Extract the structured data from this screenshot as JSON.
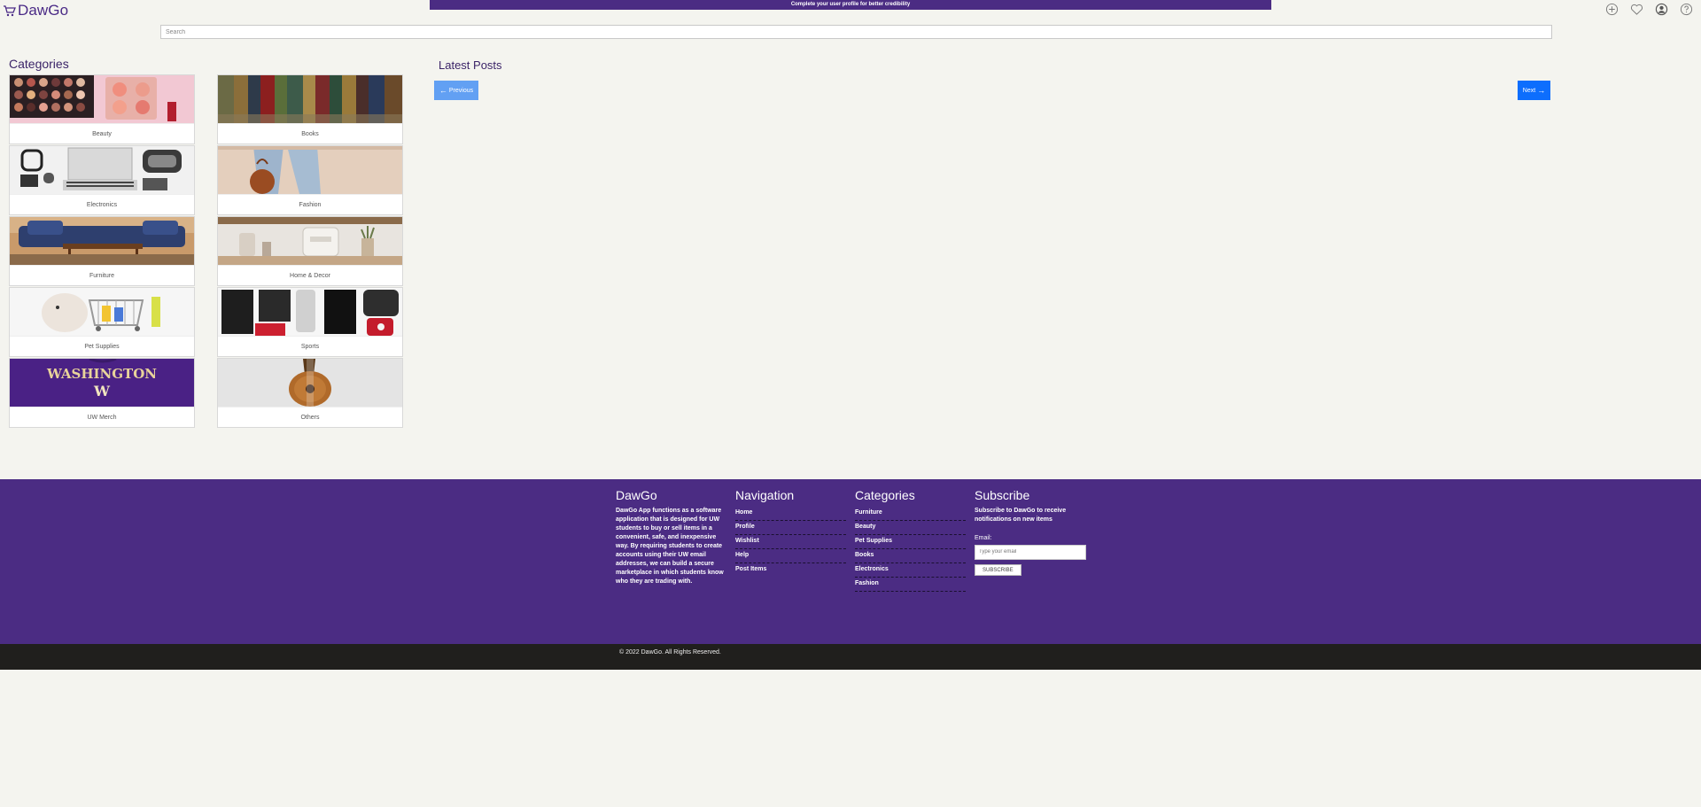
{
  "header": {
    "logo_text": "DawGo",
    "banner_text": "Complete your user profile for better credibility",
    "search_placeholder": "Search",
    "icons": [
      "add-icon",
      "heart-icon",
      "user-icon",
      "help-icon"
    ]
  },
  "categories": {
    "title": "Categories",
    "items": [
      {
        "label": "Beauty",
        "image": "beauty"
      },
      {
        "label": "Books",
        "image": "books"
      },
      {
        "label": "Electronics",
        "image": "electronics"
      },
      {
        "label": "Fashion",
        "image": "fashion"
      },
      {
        "label": "Furniture",
        "image": "furniture"
      },
      {
        "label": "Home & Decor",
        "image": "home-decor"
      },
      {
        "label": "Pet Supplies",
        "image": "pet-supplies"
      },
      {
        "label": "Sports",
        "image": "sports"
      },
      {
        "label": "UW Merch",
        "image": "uw-merch"
      },
      {
        "label": "Others",
        "image": "others"
      }
    ]
  },
  "posts": {
    "title": "Latest Posts",
    "prev_label": "Previous",
    "next_label": "Next"
  },
  "footer": {
    "about_title": "DawGo",
    "about_text": "DawGo App functions as a software application that is designed for UW students to buy or sell items in a convenient, safe, and inexpensive way. By requiring students to create accounts using their UW email addresses, we can build a secure marketplace in which students know who they are trading with.",
    "nav_title": "Navigation",
    "nav_links": [
      "Home",
      "Profile",
      "Wishlist",
      "Help",
      "Post Items"
    ],
    "cat_title": "Categories",
    "cat_links": [
      "Furniture",
      "Beauty",
      "Pet Supplies",
      "Books",
      "Electronics",
      "Fashion"
    ],
    "sub_title": "Subscribe",
    "sub_text": "Subscribe to DawGo to receive notifications on new items",
    "email_label": "Email:",
    "email_placeholder": "Type your email",
    "sub_button": "SUBSCRIBE"
  },
  "copyright": "© 2022 DawGo. All Rights Reserved.",
  "colors": {
    "brand_purple": "#4b2c83",
    "page_bg": "#f4f4ef",
    "next_blue": "#0d6efd",
    "prev_blue": "#62a0f3"
  }
}
